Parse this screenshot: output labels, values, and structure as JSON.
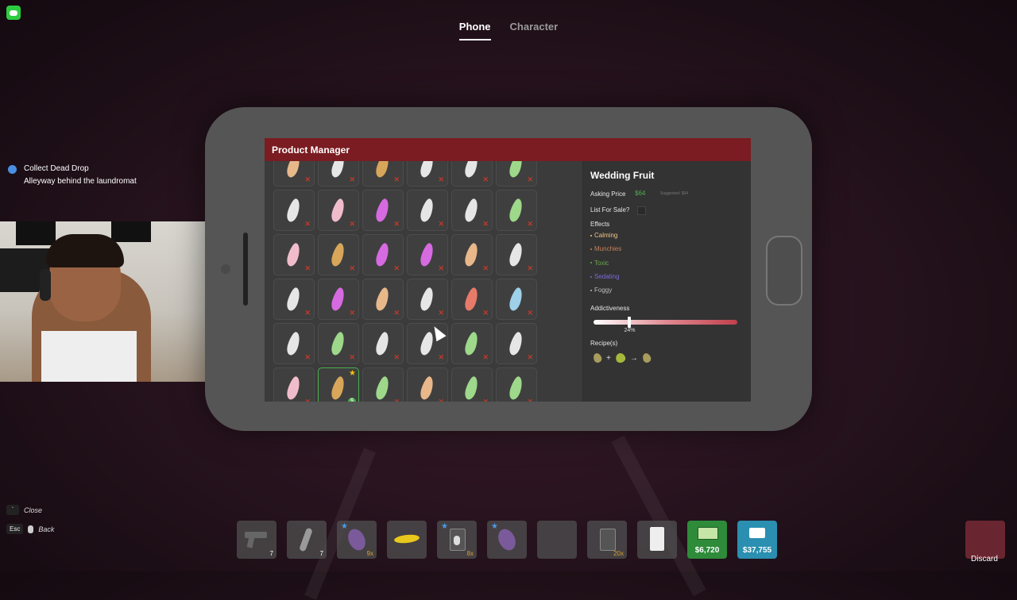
{
  "tabs": [
    {
      "label": "Phone",
      "active": true
    },
    {
      "label": "Character",
      "active": false
    }
  ],
  "quest": {
    "title": "Collect Dead Drop",
    "subtitle": "Alleyway behind the laundromat"
  },
  "app": {
    "title": "Product Manager"
  },
  "product_grid": {
    "colors": {
      "peach": "#e8b88a",
      "white": "#e6e6e6",
      "gold": "#d8a65a",
      "green": "#9ed88a",
      "pink": "#f0bccc",
      "magenta": "#d66ae0",
      "red": "#e87a6a",
      "blue": "#9ed0ea"
    },
    "rows": [
      [
        "peach",
        "white",
        "gold",
        "white",
        "white",
        "green"
      ],
      [
        "white",
        "pink",
        "magenta",
        "white",
        "white",
        "green"
      ],
      [
        "pink",
        "gold",
        "magenta",
        "magenta",
        "peach",
        "white"
      ],
      [
        "white",
        "magenta",
        "peach",
        "white",
        "red",
        "blue"
      ],
      [
        "white",
        "green",
        "white",
        "white",
        "green",
        "white"
      ],
      [
        "pink",
        "gold",
        "green",
        "peach",
        "green",
        "green"
      ]
    ],
    "selected": {
      "row": 5,
      "col": 1
    },
    "x_mark": "✕",
    "star_mark": "★",
    "money_mark": "$"
  },
  "detail": {
    "name": "Wedding Fruit",
    "asking_price_label": "Asking Price",
    "asking_price": "$64",
    "suggested": "Suggested: $64",
    "list_for_sale_label": "List For Sale?",
    "effects_label": "Effects",
    "effects": [
      {
        "name": "Calming",
        "color": "#f2c58a"
      },
      {
        "name": "Munchies",
        "color": "#c8805a"
      },
      {
        "name": "Toxic",
        "color": "#6aa84f"
      },
      {
        "name": "Sedating",
        "color": "#7a6ad8"
      },
      {
        "name": "Foggy",
        "color": "#bdbdbd"
      }
    ],
    "addictiveness_label": "Addictiveness",
    "addictiveness_value": 0.24,
    "addictiveness_pct": "24%",
    "recipes_label": "Recipe(s)",
    "recipe_plus": "+",
    "recipe_arrow": "→"
  },
  "keyhints": [
    {
      "key": "`",
      "label": "Close"
    },
    {
      "key": "Esc",
      "label": "Back"
    }
  ],
  "hotbar": [
    {
      "icon": "pistol-icon",
      "count": "7"
    },
    {
      "icon": "vial-icon",
      "count": "7"
    },
    {
      "icon": "weed-bud-icon",
      "count": "9x",
      "starred": true
    },
    {
      "icon": "banana-icon",
      "count": ""
    },
    {
      "icon": "product-bag-icon",
      "count": "8x",
      "starred": true
    },
    {
      "icon": "weed-bud-icon",
      "count": "",
      "starred": true
    },
    {
      "icon": "empty-slot",
      "count": ""
    },
    {
      "icon": "bag-icon",
      "count": "20x"
    },
    {
      "icon": "notepad-icon",
      "count": ""
    }
  ],
  "cash": "$6,720",
  "bank": "$37,755",
  "discard_label": "Discard"
}
